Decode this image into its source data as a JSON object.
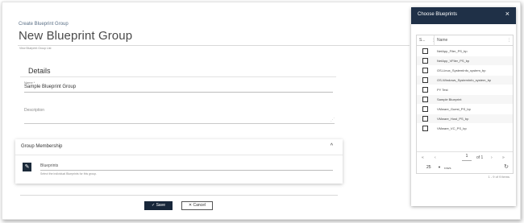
{
  "form": {
    "pre_title": "Create Blueprint Group",
    "title": "New Blueprint Group",
    "breadcrumb": "View Blueprint Group List",
    "details_heading": "Details",
    "name_label": "Name *",
    "name_value": "Sample Blueprint Group",
    "description_label": "Description",
    "description_value": ""
  },
  "membership": {
    "title": "Group Membership",
    "chevron": "^",
    "edit_icon": "pencil-icon",
    "blueprints_label": "Blueprints",
    "blueprints_help": "Select the individual Blueprints for this group."
  },
  "actions": {
    "save_label": "Save",
    "cancel_label": "Cancel",
    "save_icon": "check-icon",
    "cancel_icon": "x-icon"
  },
  "panel": {
    "title": "Choose Blueprints",
    "close_glyph": "×",
    "columns": {
      "select": "S...",
      "name": "Name"
    },
    "rows": [
      {
        "name": "NetApp_Filer_PS_bp",
        "checked": false
      },
      {
        "name": "NetApp_VFiler_PS_bp",
        "checked": false
      },
      {
        "name": "OS-Linux_SystemInfo_system_bp",
        "checked": false
      },
      {
        "name": "OS-Windows_SystemInfo_system_bp",
        "checked": false
      },
      {
        "name": "PY Test",
        "checked": false
      },
      {
        "name": "Sample Blueprint",
        "checked": false
      },
      {
        "name": "VMware_Guest_PS_bp",
        "checked": false
      },
      {
        "name": "VMware_Host_PS_bp",
        "checked": false
      },
      {
        "name": "VMware_VC_PS_bp",
        "checked": false
      }
    ],
    "pager": {
      "first": "«",
      "prev": "‹",
      "page": "1",
      "of": "of 1",
      "next": "›",
      "last": "»",
      "page_size": "25",
      "page_size_label": "rows",
      "refresh_icon": "refresh-icon",
      "items_count": "1 - 9 of 9 items"
    }
  },
  "colors": {
    "panel_header": "#1f3047",
    "save_button": "#17263a",
    "accent_text": "#5a6f86"
  }
}
